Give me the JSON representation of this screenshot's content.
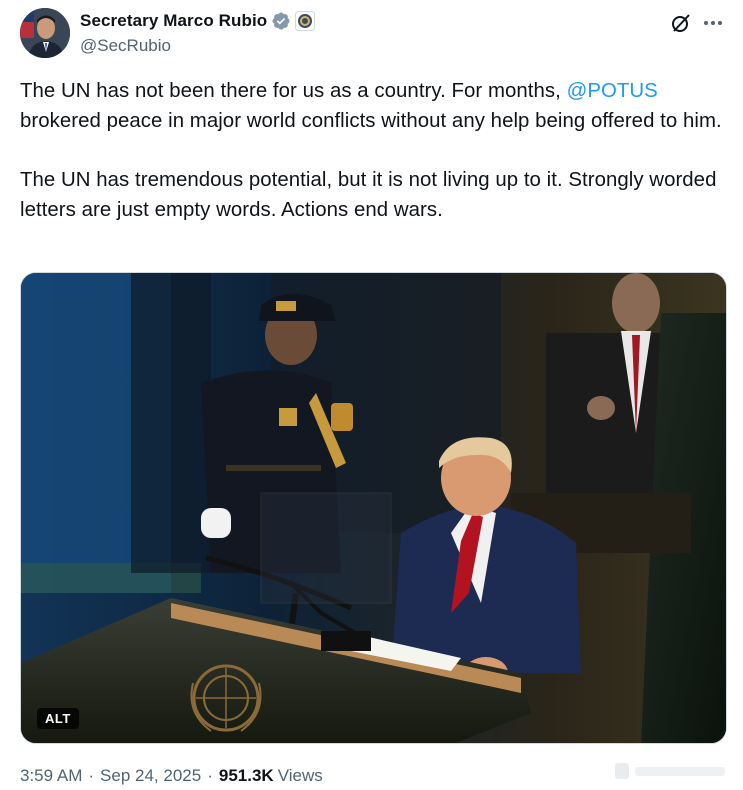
{
  "author": {
    "display_name": "Secretary Marco Rubio",
    "handle": "@SecRubio",
    "verified_badge_color": "#829aab"
  },
  "tweet": {
    "para1_before": "The UN has not been there for us as a country. For months, ",
    "mention": "@POTUS",
    "para1_after": " brokered peace in major world conflicts without any help being offered to him.",
    "para2": "The UN has tremendous potential, but it is not living up to it. Strongly worded letters are just empty words. Actions end wars.",
    "link_color": "#1d9bf0"
  },
  "media": {
    "alt_label": "ALT"
  },
  "meta": {
    "time": "3:59 AM",
    "separator": "·",
    "date": "Sep 24, 2025",
    "views_count": "951.3K",
    "views_label": "Views"
  },
  "icons": {
    "grok": "grok-icon",
    "more": "more-icon"
  }
}
